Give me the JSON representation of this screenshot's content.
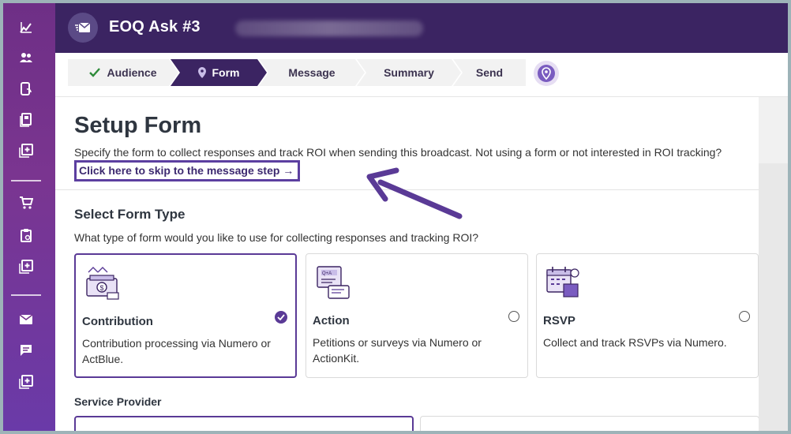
{
  "header": {
    "title": "EOQ Ask #3"
  },
  "steps": [
    {
      "label": "Audience",
      "state": "done"
    },
    {
      "label": "Form",
      "state": "active"
    },
    {
      "label": "Message",
      "state": "upcoming"
    },
    {
      "label": "Summary",
      "state": "upcoming"
    },
    {
      "label": "Send",
      "state": "upcoming"
    }
  ],
  "setup": {
    "title": "Setup Form",
    "description": "Specify the form to collect responses and track ROI when sending this broadcast. Not using a form or not interested in ROI tracking?",
    "skip_link": "Click here to skip to the message step →"
  },
  "form_type": {
    "title": "Select Form Type",
    "description": "What type of form would you like to use for collecting responses and tracking ROI?",
    "options": [
      {
        "title": "Contribution",
        "description": "Contribution processing via Numero or ActBlue.",
        "selected": true,
        "icon": "money-stack-icon"
      },
      {
        "title": "Action",
        "description": "Petitions or surveys via Numero or ActionKit.",
        "selected": false,
        "icon": "qa-survey-icon"
      },
      {
        "title": "RSVP",
        "description": "Collect and track RSVPs via Numero.",
        "selected": false,
        "icon": "calendar-icon"
      }
    ]
  },
  "service_provider": {
    "label": "Service Provider"
  },
  "colors": {
    "rail": "#74338c",
    "header": "#3b2462",
    "accent": "#5a3a96",
    "active_step": "#3b2462"
  }
}
